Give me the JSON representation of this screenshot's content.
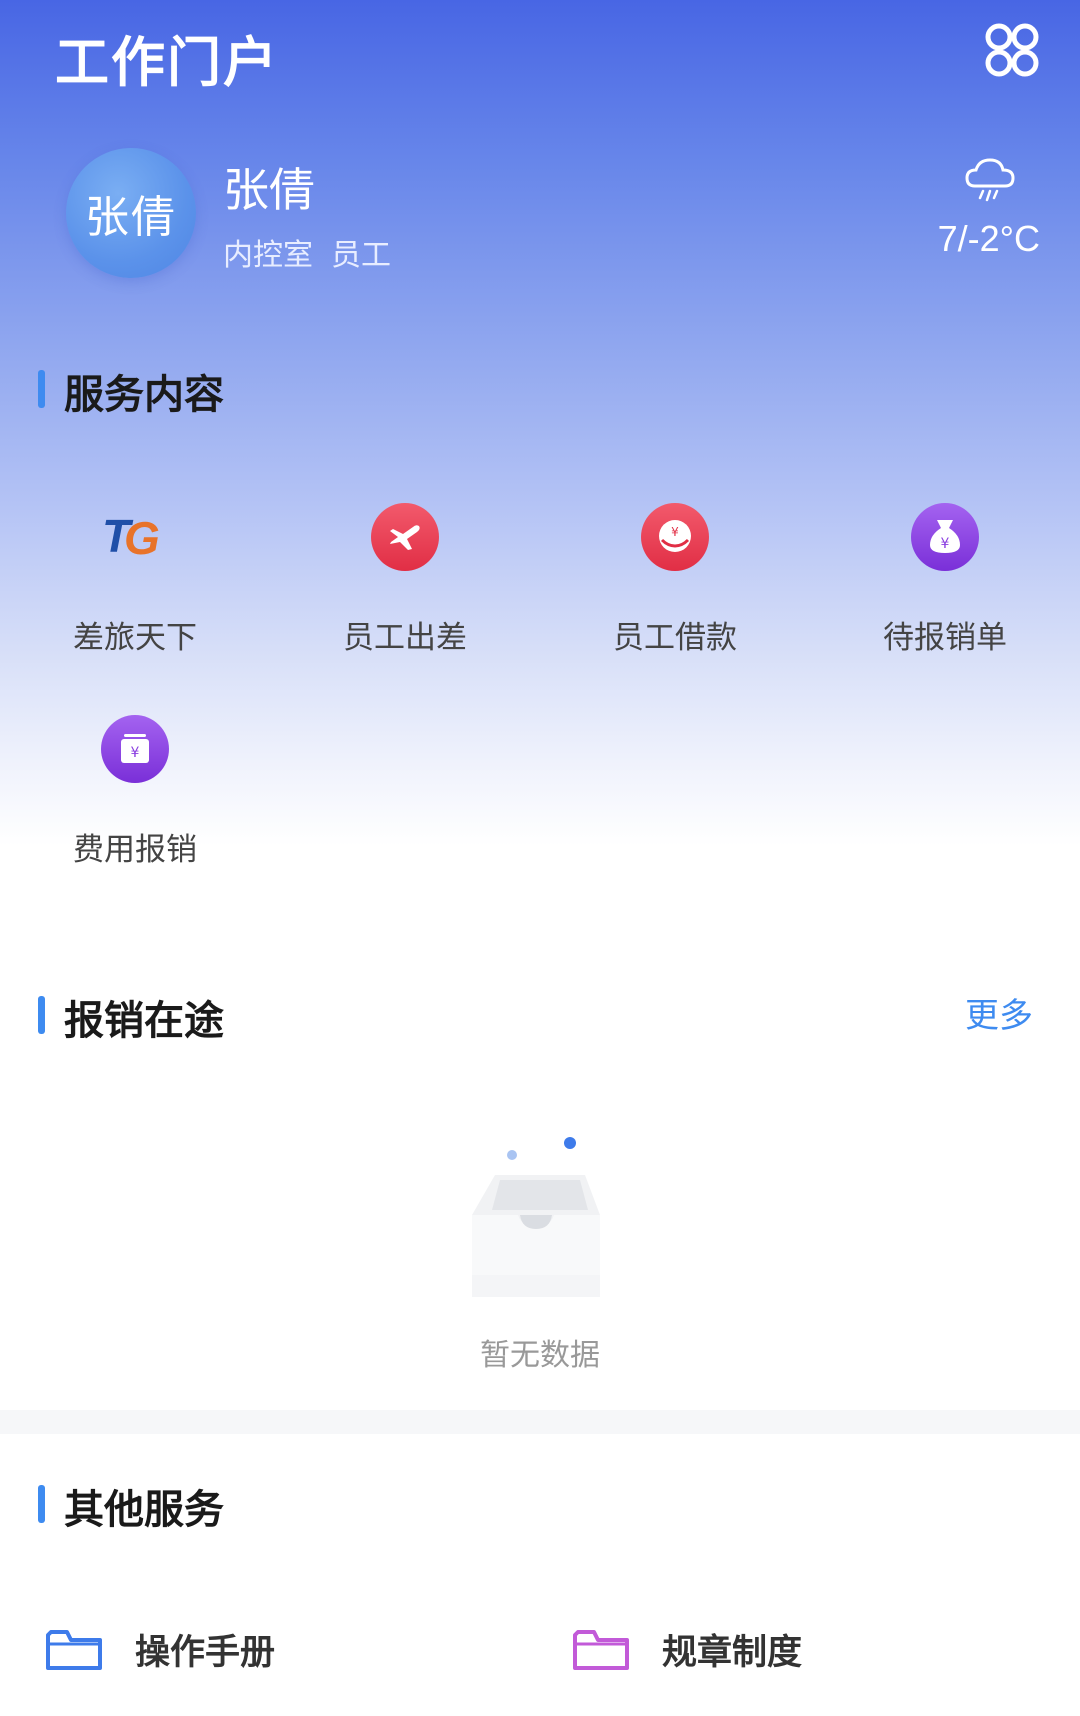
{
  "header": {
    "title": "工作门户",
    "menu_icon": "grid-icon"
  },
  "profile": {
    "avatar_text": "张倩",
    "name": "张倩",
    "department": "内控室",
    "role": "员工",
    "weather_icon": "cloud-rain-icon",
    "temperature": "7/-2°C"
  },
  "services": {
    "title": "服务内容",
    "items": [
      {
        "label": "差旅天下",
        "icon": "tg-logo-icon"
      },
      {
        "label": "员工出差",
        "icon": "airplane-icon",
        "color": "#E9384F"
      },
      {
        "label": "员工借款",
        "icon": "hand-yuan-icon",
        "color": "#E9384F"
      },
      {
        "label": "待报销单",
        "icon": "money-bag-icon",
        "color": "#8B3FE0"
      },
      {
        "label": "费用报销",
        "icon": "yuan-stack-icon",
        "color": "#8B3FE0"
      }
    ]
  },
  "in_progress": {
    "title": "报销在途",
    "more": "更多",
    "empty_text": "暂无数据"
  },
  "other": {
    "title": "其他服务",
    "items": [
      {
        "label": "操作手册",
        "icon": "folder-icon",
        "color": "#3E7BEA"
      },
      {
        "label": "规章制度",
        "icon": "folder-icon",
        "color": "#C25AD8"
      }
    ]
  },
  "colors": {
    "accent": "#3E8BF0",
    "hero_top": "#4866E4"
  }
}
